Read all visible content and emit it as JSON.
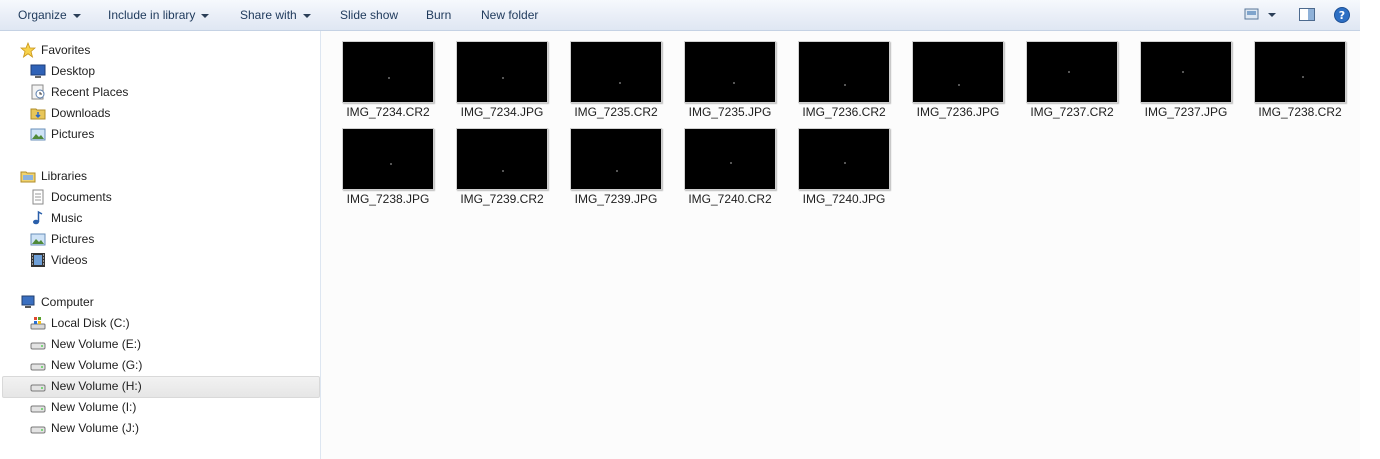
{
  "toolbar": {
    "organize": "Organize",
    "include_in_library": "Include in library",
    "share_with": "Share with",
    "slide_show": "Slide show",
    "burn": "Burn",
    "new_folder": "New folder"
  },
  "navigation": {
    "favorites": "Favorites",
    "desktop": "Desktop",
    "recent_places": "Recent Places",
    "downloads": "Downloads",
    "fav_pictures": "Pictures",
    "libraries": "Libraries",
    "documents": "Documents",
    "music": "Music",
    "lib_pictures": "Pictures",
    "videos": "Videos",
    "computer": "Computer",
    "local_disk_c": "Local Disk (C:)",
    "vol_e": "New Volume (E:)",
    "vol_g": "New Volume (G:)",
    "vol_h": "New Volume (H:)",
    "vol_i": "New Volume (I:)",
    "vol_j": "New Volume (J:)"
  },
  "files": [
    "IMG_7234.CR2",
    "IMG_7234.JPG",
    "IMG_7235.CR2",
    "IMG_7235.JPG",
    "IMG_7236.CR2",
    "IMG_7236.JPG",
    "IMG_7237.CR2",
    "IMG_7237.JPG",
    "IMG_7238.CR2",
    "IMG_7238.JPG",
    "IMG_7239.CR2",
    "IMG_7239.JPG",
    "IMG_7240.CR2",
    "IMG_7240.JPG"
  ]
}
